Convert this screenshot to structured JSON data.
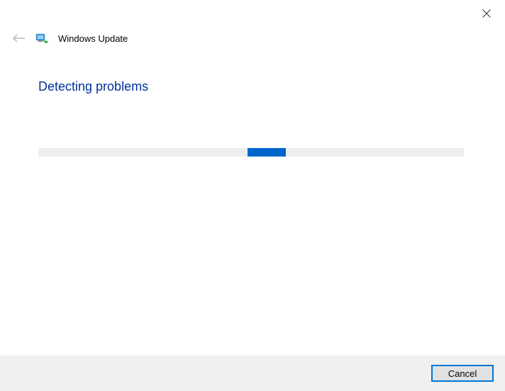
{
  "titlebar": {
    "close_label": "Close"
  },
  "header": {
    "back_label": "Back",
    "app_title": "Windows Update"
  },
  "main": {
    "heading": "Detecting problems"
  },
  "progress": {
    "state": "indeterminate"
  },
  "footer": {
    "cancel_label": "Cancel"
  },
  "colors": {
    "heading": "#003399",
    "progress_fill": "#0066cc",
    "progress_track": "#eeeeee",
    "footer_bg": "#f0f0f0",
    "button_border": "#0078d7"
  }
}
